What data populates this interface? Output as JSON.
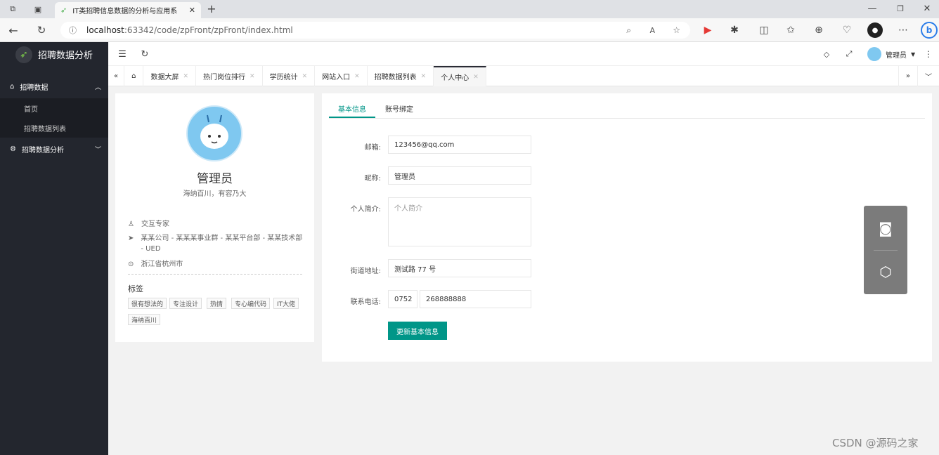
{
  "browser": {
    "tab_title": "IT类招聘信息数据的分析与应用系",
    "url_host": "localhost",
    "url_rest": ":63342/code/zpFront/zpFront/index.html"
  },
  "app": {
    "logo_text": "招聘数据分析",
    "user_name": "管理员"
  },
  "sidebar": {
    "groups": [
      {
        "label": "招聘数据",
        "items": [
          "首页",
          "招聘数据列表"
        ]
      },
      {
        "label": "招聘数据分析"
      }
    ]
  },
  "pagetabs": [
    "数据大屏",
    "热门岗位排行",
    "学历统计",
    "网站入口",
    "招聘数据列表",
    "个人中心"
  ],
  "profile": {
    "name": "管理员",
    "motto": "海纳百川，有容乃大",
    "role": "交互专家",
    "org": "某某公司 - 某某某事业群 - 某某平台部 - 某某技术部 - UED",
    "location": "浙江省杭州市",
    "tags_title": "标签",
    "tags": [
      "很有想法的",
      "专注设计",
      "热情",
      "专心编代码",
      "IT大佬",
      "海纳百川"
    ]
  },
  "form": {
    "tabs": [
      "基本信息",
      "账号绑定"
    ],
    "email_label": "邮箱:",
    "email_value": "123456@qq.com",
    "nickname_label": "昵称:",
    "nickname_value": "管理员",
    "bio_label": "个人简介:",
    "bio_placeholder": "个人简介",
    "address_label": "街道地址:",
    "address_value": "测试路 77 号",
    "phone_label": "联系电话:",
    "phone_area": "0752",
    "phone_number": "268888888",
    "submit_label": "更新基本信息"
  },
  "watermark": "CSDN @源码之家",
  "colors": {
    "accent": "#009688",
    "sidebar": "#23262e"
  }
}
